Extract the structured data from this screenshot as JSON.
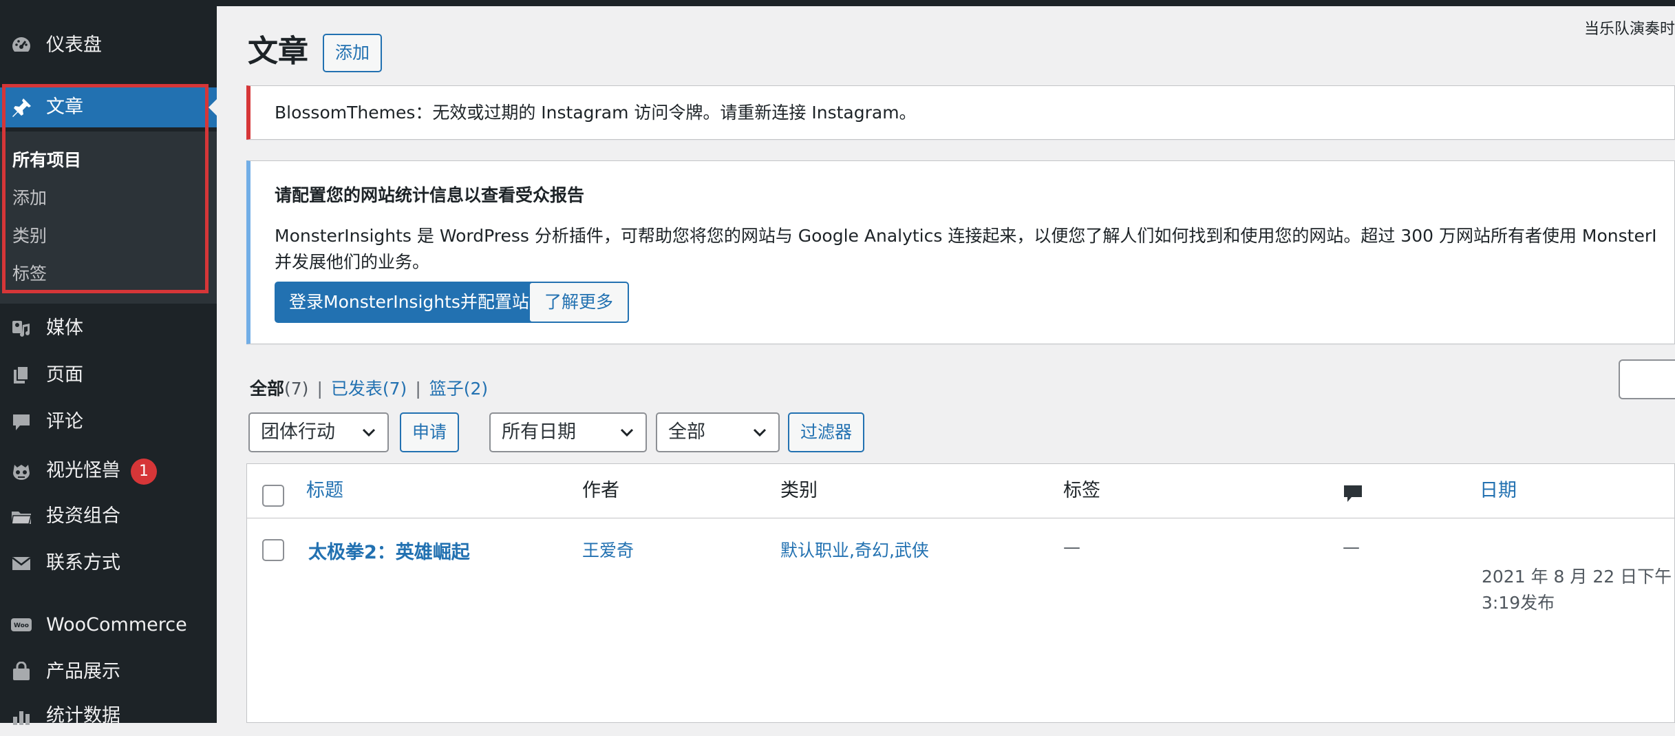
{
  "sidebar": {
    "items": [
      {
        "label": "仪表盘",
        "icon": "dashboard-icon"
      },
      {
        "label": "文章",
        "icon": "pushpin-icon"
      },
      {
        "label": "媒体",
        "icon": "media-icon"
      },
      {
        "label": "页面",
        "icon": "pages-icon"
      },
      {
        "label": "评论",
        "icon": "comment-icon"
      },
      {
        "label": "视光怪兽",
        "icon": "monster-icon",
        "badge": "1"
      },
      {
        "label": "投资组合",
        "icon": "portfolio-folder-icon"
      },
      {
        "label": "联系方式",
        "icon": "envelope-icon"
      },
      {
        "label": "WooCommerce",
        "icon": "woocommerce-icon"
      },
      {
        "label": "产品展示",
        "icon": "product-bag-icon"
      },
      {
        "label": "统计数据",
        "icon": "stats-icon"
      }
    ],
    "submenu": [
      "所有项目",
      "添加",
      "类别",
      "标签"
    ]
  },
  "header": {
    "title": "文章",
    "add_label": "添加",
    "screen_options": "当乐队演奏时"
  },
  "notices": {
    "error_text": "BlossomThemes：无效或过期的 Instagram 访问令牌。请重新连接 Instagram。",
    "info_heading": "请配置您的网站统计信息以查看受众报告",
    "info_body_1": "MonsterInsights 是 WordPress 分析插件，可帮助您将您的网站与 Google Analytics 连接起来，以便您了解人们如何找到和使用您的网站。超过 300 万网站所有者使用 MonsterI",
    "info_body_2": "并发展他们的业务。",
    "primary_button": "登录MonsterInsights并配置站点统计",
    "secondary_button": "了解更多"
  },
  "filters": {
    "all_label": "全部",
    "all_count": "(7)",
    "published_label": "已发表",
    "published_count": "(7)",
    "trash_label": "篮子",
    "trash_count": "(2)",
    "separator": "|",
    "bulk_action": "团体行动",
    "apply": "申请",
    "dates": "所有日期",
    "category": "全部",
    "filter": "过滤器"
  },
  "table": {
    "headers": {
      "title": "标题",
      "author": "作者",
      "categories": "类别",
      "tags": "标签",
      "date": "日期"
    },
    "rows": [
      {
        "title": "太极拳2：英雄崛起",
        "author": "王爱奇",
        "categories": "默认职业,奇幻,武侠",
        "tags": "—",
        "comments": "—",
        "date_line1": "2021 年 8 月 22 日下午",
        "date_line2": "3:19发布"
      }
    ]
  },
  "colors": {
    "sidebar_bg": "#1d2327",
    "submenu_bg": "#2c3338",
    "accent": "#2271b1",
    "error": "#d63638",
    "info": "#72aee6"
  }
}
